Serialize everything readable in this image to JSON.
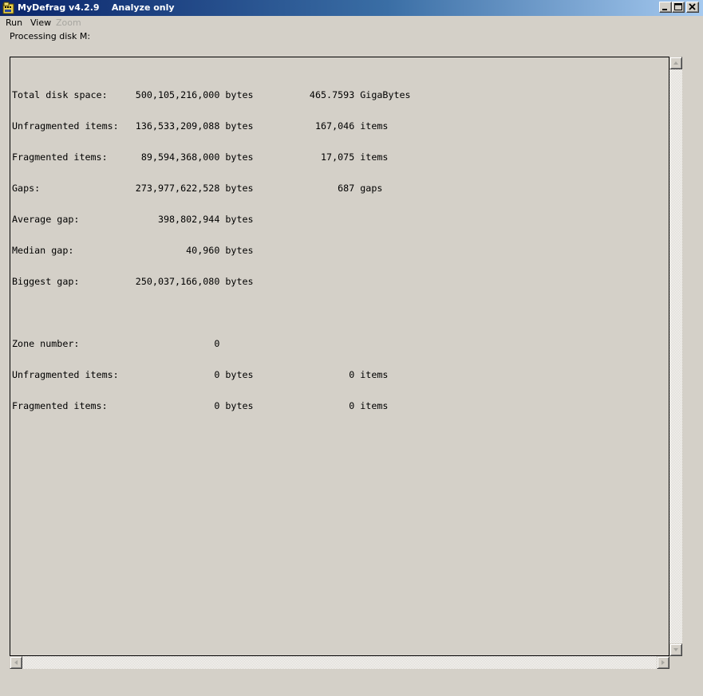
{
  "window": {
    "title": "MyDefrag v4.2.9    Analyze only",
    "controls": [
      "minimize-icon",
      "maximize-icon",
      "close-icon"
    ]
  },
  "menu": {
    "items": [
      {
        "label": "Run",
        "enabled": true
      },
      {
        "label": "View",
        "enabled": true
      },
      {
        "label": "Zoom",
        "enabled": false
      }
    ]
  },
  "status": {
    "text": "Processing disk M:"
  },
  "output": {
    "lines": [
      "Total disk space:     500,105,216,000 bytes          465.7593 GigaBytes",
      "Unfragmented items:   136,533,209,088 bytes           167,046 items",
      "Fragmented items:      89,594,368,000 bytes            17,075 items",
      "Gaps:                 273,977,622,528 bytes               687 gaps",
      "Average gap:              398,802,944 bytes",
      "Median gap:                    40,960 bytes",
      "Biggest gap:          250,037,166,080 bytes",
      "",
      "Zone number:                        0",
      "Unfragmented items:                 0 bytes                 0 items",
      "Fragmented items:                   0 bytes                 0 items"
    ]
  },
  "scrollbars": {
    "vertical_icons": [
      "scroll-up-arrow-icon",
      "scroll-down-arrow-icon"
    ],
    "horizontal_icons": [
      "scroll-left-arrow-icon",
      "scroll-right-arrow-icon"
    ]
  },
  "colors": {
    "titlebar_start": "#0a246a",
    "titlebar_end": "#a6caf0",
    "face": "#d4d0c8",
    "disabled_text": "#a7a6a0"
  }
}
